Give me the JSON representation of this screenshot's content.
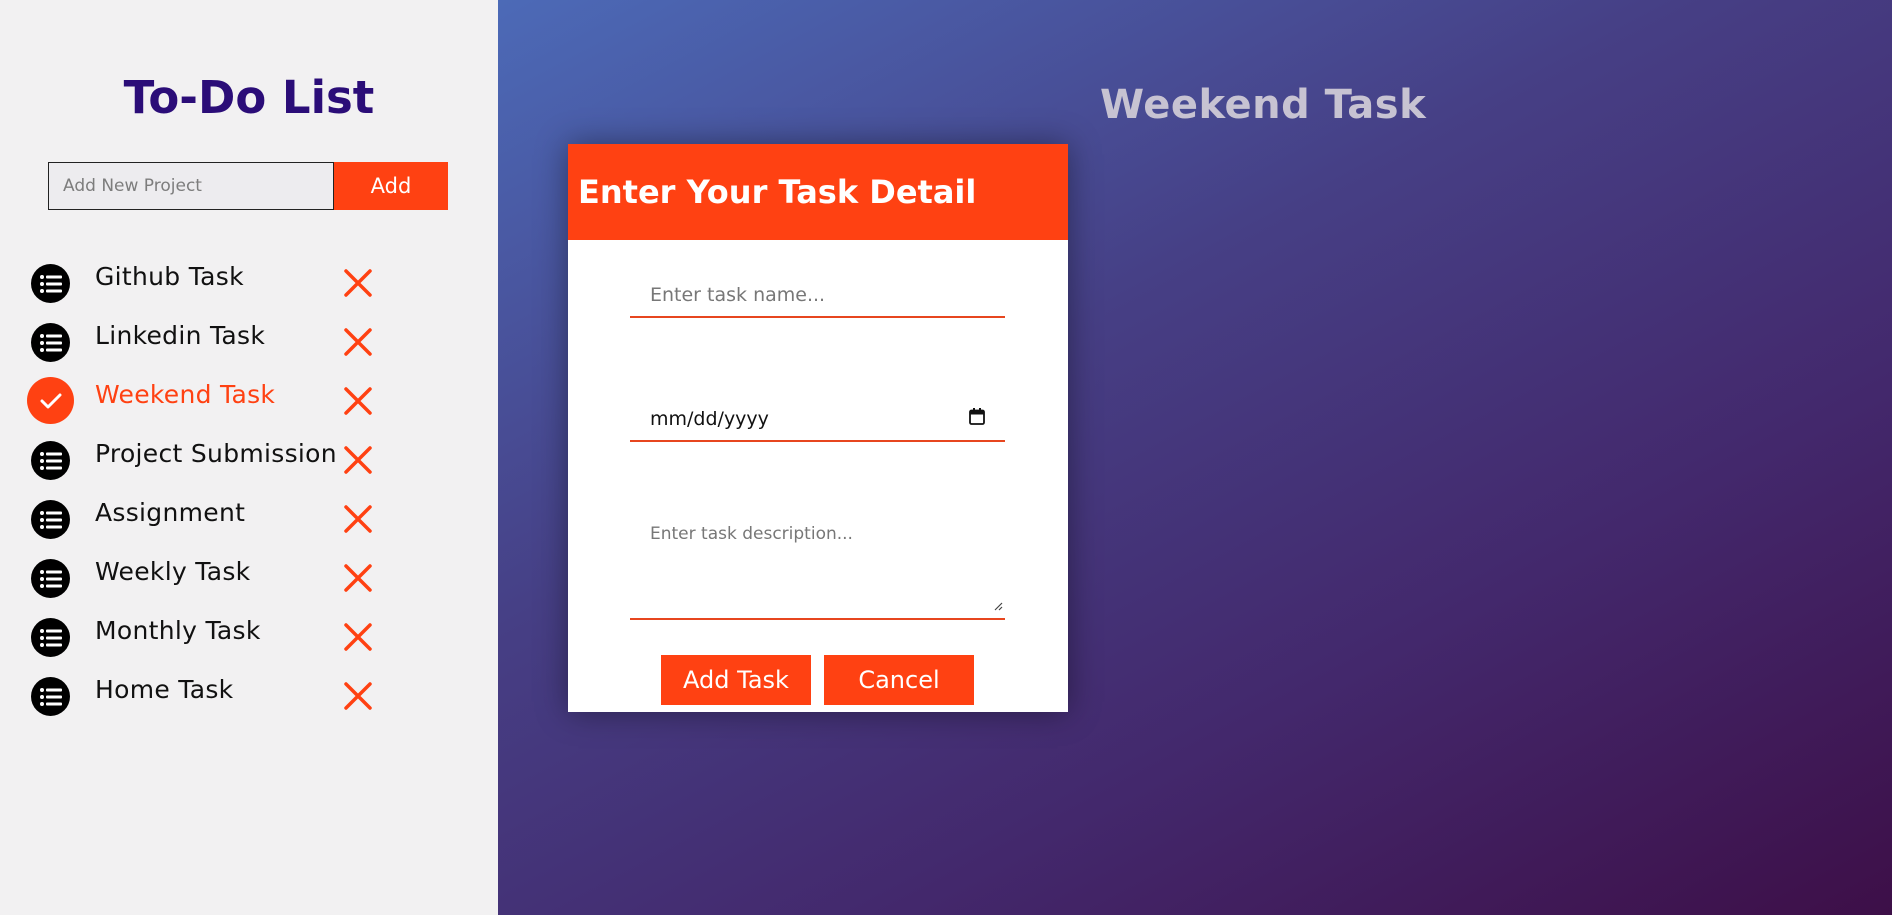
{
  "sidebar": {
    "title": "To-Do List",
    "new_project_placeholder": "Add New Project",
    "add_label": "Add",
    "projects": [
      {
        "label": "Github Task",
        "active": false
      },
      {
        "label": "Linkedin Task",
        "active": false
      },
      {
        "label": "Weekend Task",
        "active": true
      },
      {
        "label": "Project Submission",
        "active": false
      },
      {
        "label": "Assignment",
        "active": false
      },
      {
        "label": "Weekly Task",
        "active": false
      },
      {
        "label": "Monthly Task",
        "active": false
      },
      {
        "label": "Home Task",
        "active": false
      }
    ]
  },
  "main": {
    "title": "Weekend Task"
  },
  "modal": {
    "header": "Enter Your Task Detail",
    "task_name_placeholder": "Enter task name...",
    "date_placeholder": "mm/dd/yyyy",
    "description_placeholder": "Enter task description...",
    "add_task_label": "Add Task",
    "cancel_label": "Cancel"
  },
  "icons": {
    "project": "list-icon",
    "active_project": "check-icon",
    "delete": "close-icon",
    "date": "calendar-icon"
  },
  "colors": {
    "accent": "#ff4112",
    "title": "#2b0d78",
    "sidebar_bg": "#f2f1f2"
  }
}
